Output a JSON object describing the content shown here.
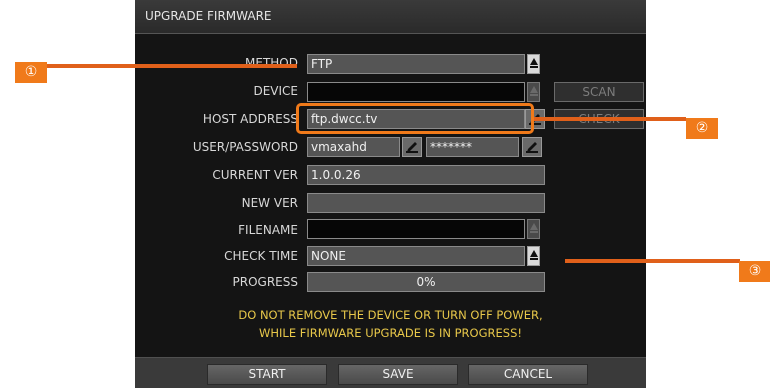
{
  "dialog": {
    "title": "UPGRADE FIRMWARE",
    "rows": {
      "method": {
        "label": "METHOD",
        "value": "FTP"
      },
      "device": {
        "label": "DEVICE",
        "value": ""
      },
      "host_address": {
        "label": "HOST ADDRESS",
        "value": "ftp.dwcc.tv"
      },
      "user_password": {
        "label": "USER/PASSWORD",
        "user": "vmaxahd",
        "password": "*******"
      },
      "current_ver": {
        "label": "CURRENT VER",
        "value": "1.0.0.26"
      },
      "new_ver": {
        "label": "NEW VER",
        "value": ""
      },
      "filename": {
        "label": "FILENAME",
        "value": ""
      },
      "check_time": {
        "label": "CHECK TIME",
        "value": "NONE"
      },
      "progress": {
        "label": "PROGRESS",
        "value": "0%",
        "fraction": 0
      }
    },
    "side_buttons": {
      "scan": "SCAN",
      "check": "CHECK"
    },
    "warning": {
      "line1": "DO NOT REMOVE THE DEVICE OR TURN OFF POWER,",
      "line2": "WHILE FIRMWARE UPGRADE IS IN PROGRESS!"
    },
    "buttons": {
      "start": "START",
      "save": "SAVE",
      "cancel": "CANCEL"
    }
  },
  "callouts": {
    "one": "①",
    "two": "②",
    "three": "③"
  },
  "colors": {
    "accent": "#f07a1a",
    "warning_text": "#e8c84a",
    "dialog_bg": "#141414"
  },
  "icons": {
    "dropdown": "dropdown-arrow-icon",
    "edit": "pencil-keyboard-icon"
  }
}
